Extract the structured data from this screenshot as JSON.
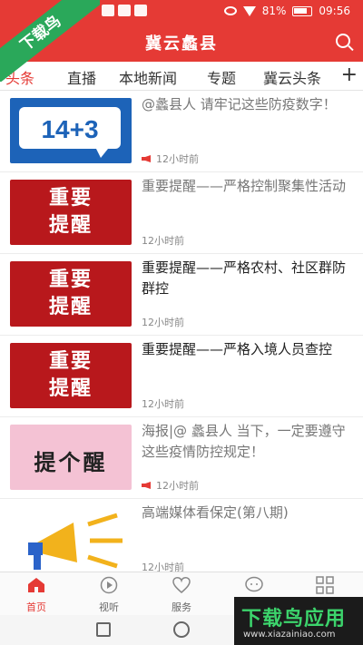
{
  "status_bar": {
    "battery": "81%",
    "time": "09:56"
  },
  "header": {
    "title": "冀云蠡县"
  },
  "tabs": [
    {
      "label": "头条"
    },
    {
      "label": "直播"
    },
    {
      "label": "本地新闻"
    },
    {
      "label": "专题"
    },
    {
      "label": "冀云头条"
    }
  ],
  "tabs_add": "+",
  "feed": [
    {
      "headline": "@蠡县人 请牢记这些防疫数字！",
      "thumb_text": "14+3",
      "time": "12小时前",
      "audio": true
    },
    {
      "headline": "重要提醒——严格控制聚集性活动",
      "thumb_text": "重要\n提醒",
      "time": "12小时前",
      "audio": false
    },
    {
      "headline": "重要提醒——严格农村、社区群防群控",
      "thumb_text": "重要\n提醒",
      "time": "12小时前",
      "audio": false
    },
    {
      "headline": "重要提醒——严格入境人员查控",
      "thumb_text": "重要\n提醒",
      "time": "12小时前",
      "audio": false
    },
    {
      "headline": "海报|@ 蠡县人 当下，一定要遵守这些疫情防控规定！",
      "thumb_text": "提个醒",
      "time": "12小时前",
      "audio": true
    },
    {
      "headline": "高端媒体看保定(第八期)",
      "thumb_text": "",
      "time": "12小时前",
      "audio": false
    }
  ],
  "bottom_nav": [
    {
      "label": "首页",
      "icon": "home-icon"
    },
    {
      "label": "视听",
      "icon": "play-icon"
    },
    {
      "label": "服务",
      "icon": "heart-icon"
    },
    {
      "label": "",
      "icon": "chat-icon"
    },
    {
      "label": "",
      "icon": "grid-icon"
    }
  ],
  "watermark": {
    "top_badge": "下载鸟",
    "bottom_title": "下载鸟应用",
    "bottom_url": "www.xiazainiao.com"
  },
  "colors": {
    "accent": "#e53a35",
    "thumb_red": "#b8181c"
  }
}
